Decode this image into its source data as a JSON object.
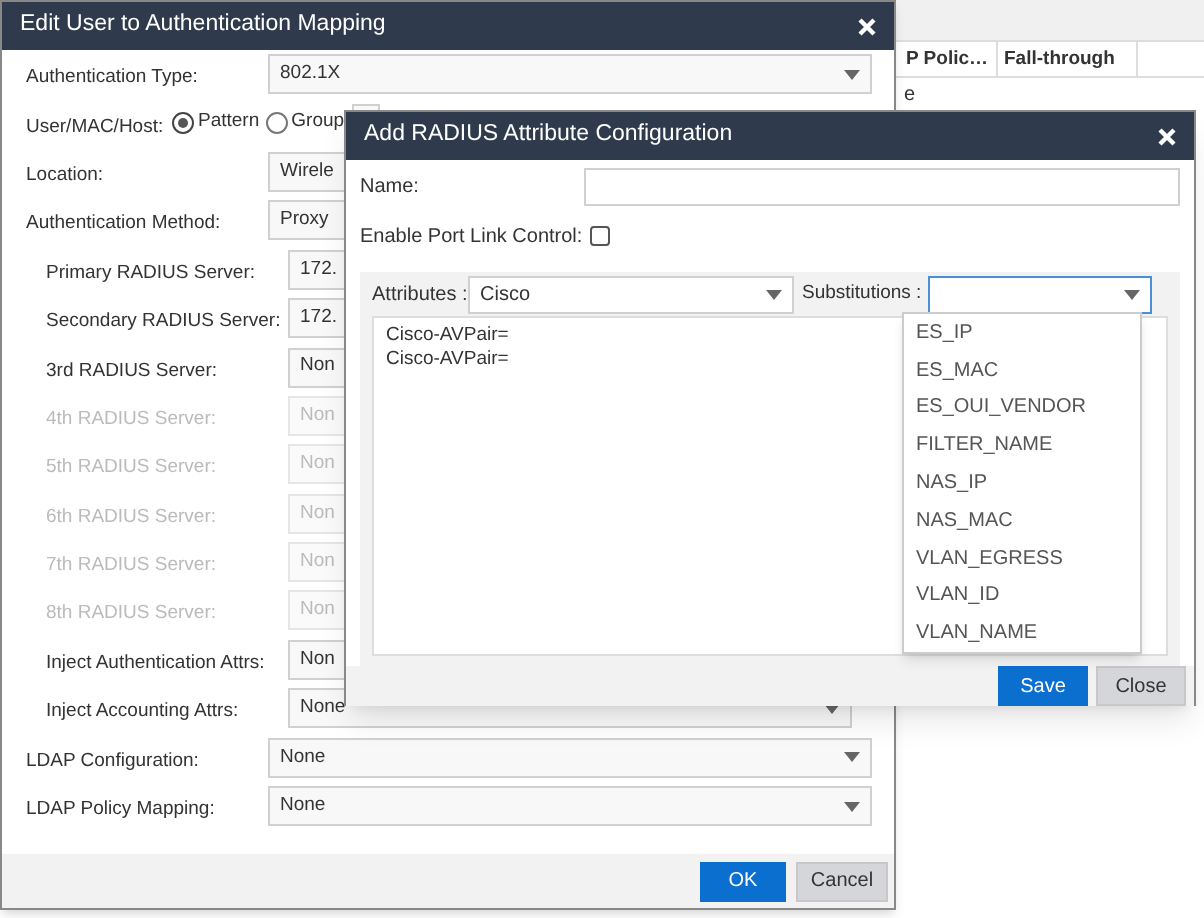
{
  "background_table": {
    "columns": [
      "P Polic…",
      "Fall-through"
    ],
    "rows": [
      [
        "e"
      ]
    ]
  },
  "edit_dialog": {
    "title": "Edit User to Authentication Mapping",
    "fields": [
      {
        "kind": "select",
        "label": "Authentication Type:",
        "value": "802.1X",
        "disabled": false
      },
      {
        "kind": "radio",
        "label": "User/MAC/Host:",
        "options": [
          {
            "label": "Pattern",
            "selected": true
          },
          {
            "label": "Group",
            "selected": false
          }
        ]
      },
      {
        "kind": "select",
        "label": "Location:",
        "value": "Wirele",
        "disabled": false
      },
      {
        "kind": "select",
        "label": "Authentication Method:",
        "value": "Proxy",
        "disabled": false,
        "children": [
          {
            "kind": "select",
            "label": "Primary RADIUS Server:",
            "value": "172.",
            "disabled": false
          },
          {
            "kind": "select",
            "label": "Secondary RADIUS Server:",
            "value": "172.",
            "disabled": false
          },
          {
            "kind": "select",
            "label": "3rd RADIUS Server:",
            "value": "Non",
            "disabled": false
          },
          {
            "kind": "select",
            "label": "4th RADIUS Server:",
            "value": "Non",
            "disabled": true
          },
          {
            "kind": "select",
            "label": "5th RADIUS Server:",
            "value": "Non",
            "disabled": true
          },
          {
            "kind": "select",
            "label": "6th RADIUS Server:",
            "value": "Non",
            "disabled": true
          },
          {
            "kind": "select",
            "label": "7th RADIUS Server:",
            "value": "Non",
            "disabled": true
          },
          {
            "kind": "select",
            "label": "8th RADIUS Server:",
            "value": "Non",
            "disabled": true
          },
          {
            "kind": "select",
            "label": "Inject Authentication Attrs:",
            "value": "Non",
            "disabled": false
          },
          {
            "kind": "select",
            "label": "Inject Accounting Attrs:",
            "value": "None",
            "disabled": false
          }
        ]
      },
      {
        "kind": "select",
        "label": "LDAP Configuration:",
        "value": "None",
        "disabled": false
      },
      {
        "kind": "select",
        "label": "LDAP Policy Mapping:",
        "value": "None",
        "disabled": false
      }
    ],
    "buttons": [
      {
        "label": "OK",
        "kind": "primary"
      },
      {
        "label": "Cancel",
        "kind": "secondary"
      }
    ]
  },
  "radius_dialog": {
    "title": "Add RADIUS Attribute Configuration",
    "name": {
      "label": "Name:"
    },
    "port_link_control": {
      "label": "Enable Port Link Control:",
      "checked": false
    },
    "attributes": {
      "label": "Attributes :",
      "value": "Cisco"
    },
    "substitutions": {
      "label": "Substitutions :",
      "expanded": true,
      "options": [
        "ES_IP",
        "ES_MAC",
        "ES_OUI_VENDOR",
        "FILTER_NAME",
        "NAS_IP",
        "NAS_MAC",
        "VLAN_EGRESS",
        "VLAN_ID",
        "VLAN_NAME"
      ]
    },
    "text_lines": [
      "Cisco-AVPair=",
      "Cisco-AVPair="
    ],
    "buttons": [
      {
        "label": "Save",
        "kind": "primary"
      },
      {
        "label": "Close",
        "kind": "secondary"
      }
    ]
  }
}
